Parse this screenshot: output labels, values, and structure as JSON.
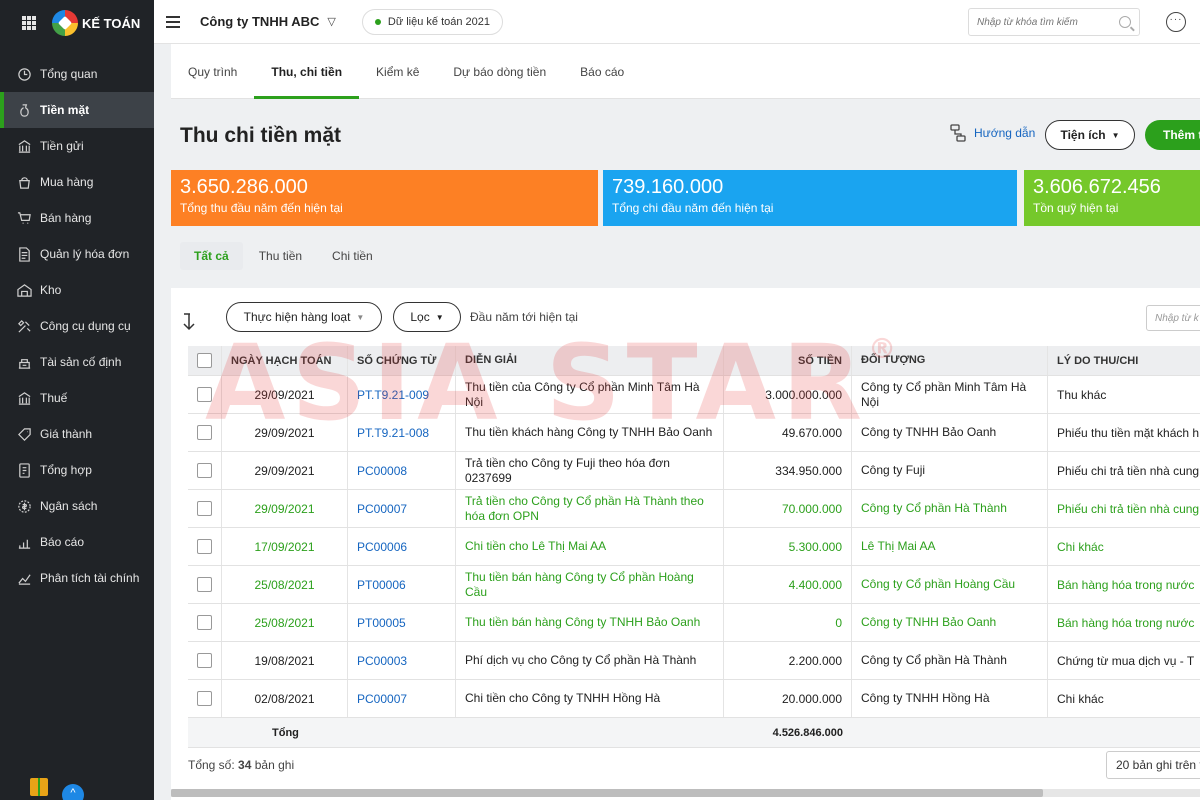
{
  "app": {
    "brand": "KẾ TOÁN"
  },
  "sidebar": {
    "items": [
      {
        "label": "Tổng quan",
        "icon": "clock-icon"
      },
      {
        "label": "Tiền mặt",
        "icon": "money-bag-icon",
        "active": true
      },
      {
        "label": "Tiền gửi",
        "icon": "bank-icon"
      },
      {
        "label": "Mua hàng",
        "icon": "shopping-bag-icon"
      },
      {
        "label": "Bán hàng",
        "icon": "cart-icon"
      },
      {
        "label": "Quản lý hóa đơn",
        "icon": "invoice-icon"
      },
      {
        "label": "Kho",
        "icon": "warehouse-icon"
      },
      {
        "label": "Công cụ dụng cụ",
        "icon": "tools-icon"
      },
      {
        "label": "Tài sản cố định",
        "icon": "asset-icon"
      },
      {
        "label": "Thuế",
        "icon": "tax-icon"
      },
      {
        "label": "Giá thành",
        "icon": "price-tag-icon"
      },
      {
        "label": "Tổng hợp",
        "icon": "summary-icon"
      },
      {
        "label": "Ngân sách",
        "icon": "budget-icon"
      },
      {
        "label": "Báo cáo",
        "icon": "bar-chart-icon"
      },
      {
        "label": "Phân tích tài chính",
        "icon": "analysis-icon"
      }
    ]
  },
  "topbar": {
    "company": "Công ty TNHH ABC",
    "data_label": "Dữ liệu kế toán 2021",
    "search_placeholder": "Nhập từ khóa tìm kiếm",
    "more": "···"
  },
  "subtabs": [
    "Quy trình",
    "Thu, chi tiền",
    "Kiểm kê",
    "Dự báo dòng tiền",
    "Báo cáo"
  ],
  "page": {
    "title": "Thu chi tiền mặt",
    "help": "Hướng dẫn",
    "utilities": "Tiện ích",
    "add": "Thêm t"
  },
  "stats": [
    {
      "value": "3.650.286.000",
      "label": "Tổng thu đầu năm đến hiện tại",
      "color": "#fd8024"
    },
    {
      "value": "739.160.000",
      "label": "Tổng chi đầu năm đến hiện tại",
      "color": "#1aa4f0"
    },
    {
      "value": "3.606.672.456",
      "label": "Tồn quỹ hiện tại",
      "color": "#75c82b"
    }
  ],
  "filter_tabs": [
    "Tất cả",
    "Thu tiền",
    "Chi tiền"
  ],
  "toolbar": {
    "bulk": "Thực hiện hàng loạt",
    "filter": "Lọc",
    "range": "Đầu năm tới hiện tại",
    "search_placeholder": "Nhập từ k"
  },
  "table": {
    "columns": [
      "Ngày hạch toán",
      "Số chứng từ",
      "Diễn giải",
      "Số tiền",
      "Đối tượng",
      "Lý do thu/chi"
    ],
    "rows": [
      {
        "date": "29/09/2021",
        "doc": "PT.T9.21-009",
        "desc": "Thu tiền của Công ty Cổ phần Minh Tâm Hà Nội",
        "amount": "3.000.000.000",
        "object": "Công ty Cổ phần Minh Tâm Hà Nội",
        "reason": "Thu khác",
        "green": false
      },
      {
        "date": "29/09/2021",
        "doc": "PT.T9.21-008",
        "desc": "Thu tiền khách hàng Công ty TNHH Bảo Oanh",
        "amount": "49.670.000",
        "object": "Công ty TNHH Bảo Oanh",
        "reason": "Phiếu thu tiền mặt khách h",
        "green": false
      },
      {
        "date": "29/09/2021",
        "doc": "PC00008",
        "desc": "Trả tiền cho Công ty Fuji theo hóa đơn 0237699",
        "amount": "334.950.000",
        "object": "Công ty Fuji",
        "reason": "Phiếu chi trả tiền nhà cung",
        "green": false
      },
      {
        "date": "29/09/2021",
        "doc": "PC00007",
        "desc": "Trả tiền cho Công ty Cổ phần Hà Thành theo hóa đơn OPN",
        "amount": "70.000.000",
        "object": "Công ty Cổ phần Hà Thành",
        "reason": "Phiếu chi trả tiền nhà cung",
        "green": true
      },
      {
        "date": "17/09/2021",
        "doc": "PC00006",
        "desc": "Chi tiền cho Lê Thị Mai AA",
        "amount": "5.300.000",
        "object": "Lê Thị Mai AA",
        "reason": "Chi khác",
        "green": true
      },
      {
        "date": "25/08/2021",
        "doc": "PT00006",
        "desc": "Thu tiền bán hàng Công ty Cổ phần Hoàng Cầu",
        "amount": "4.400.000",
        "object": "Công ty Cổ phần Hoàng Cầu",
        "reason": "Bán hàng hóa trong nước",
        "green": true
      },
      {
        "date": "25/08/2021",
        "doc": "PT00005",
        "desc": "Thu tiền bán hàng Công ty TNHH Bảo Oanh",
        "amount": "0",
        "object": "Công ty TNHH Bảo Oanh",
        "reason": "Bán hàng hóa trong nước",
        "green": true
      },
      {
        "date": "19/08/2021",
        "doc": "PC00003",
        "desc": "Phí dịch vụ cho Công ty Cổ phần Hà Thành",
        "amount": "2.200.000",
        "object": "Công ty Cổ phần Hà Thành",
        "reason": "Chứng từ mua dịch vụ - T",
        "green": false
      },
      {
        "date": "02/08/2021",
        "doc": "PC00007",
        "desc": "Chi tiền cho Công ty TNHH Hồng Hà",
        "amount": "20.000.000",
        "object": "Công ty TNHH Hồng Hà",
        "reason": "Chi khác",
        "green": false
      }
    ],
    "total_label": "Tổng",
    "total_amount": "4.526.846.000"
  },
  "footer": {
    "count_prefix": "Tổng số:",
    "count": "34",
    "count_suffix": "bản ghi",
    "page_size": "20 bản ghi trên t"
  },
  "watermark": {
    "text": "ASIA STAR",
    "mark": "®"
  }
}
